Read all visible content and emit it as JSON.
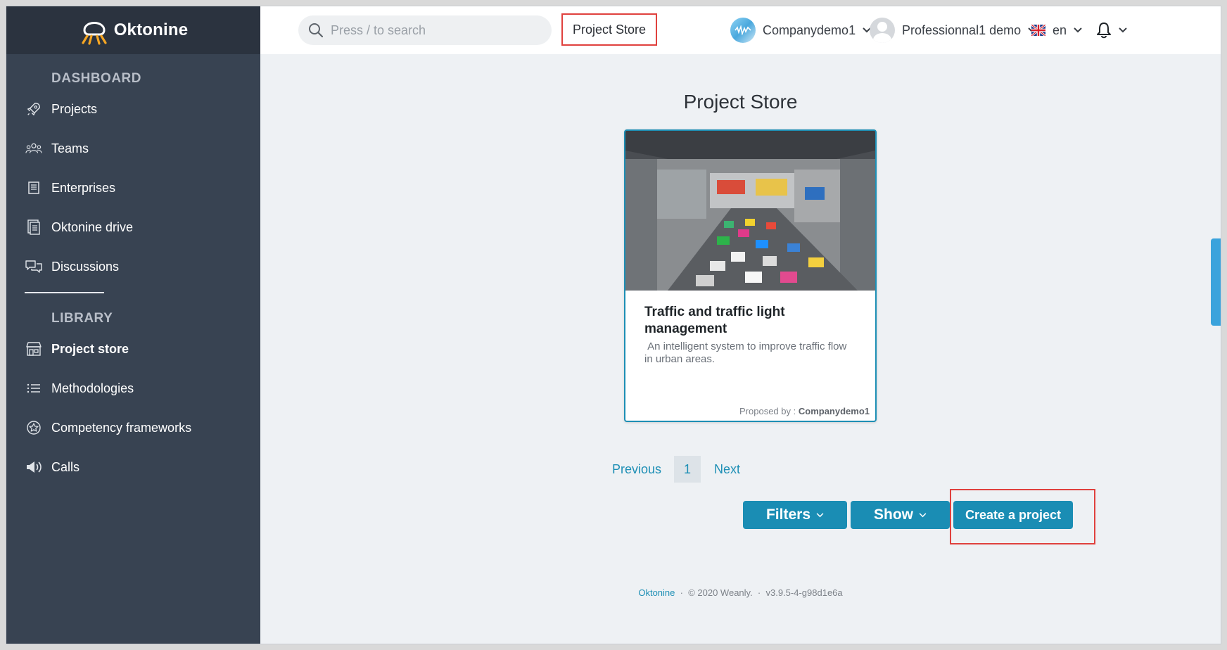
{
  "brand": {
    "name": "Oktonine",
    "accent": "#1a8db4",
    "sidebar_bg": "#384352"
  },
  "search": {
    "placeholder": "Press / to search"
  },
  "header": {
    "active_tab": "Project Store",
    "company": "Companydemo1",
    "user": "Professionnal1 demo",
    "language": "en",
    "icons": [
      "search-icon",
      "chevron-down-icon",
      "uk-flag-icon",
      "bell-icon"
    ]
  },
  "sidebar": {
    "dashboard_title": "DASHBOARD",
    "library_title": "LIBRARY",
    "dashboard_items": [
      {
        "label": "Projects",
        "icon": "rocket-icon"
      },
      {
        "label": "Teams",
        "icon": "team-icon"
      },
      {
        "label": "Enterprises",
        "icon": "enterprise-icon"
      },
      {
        "label": "Oktonine drive",
        "icon": "drive-icon"
      },
      {
        "label": "Discussions",
        "icon": "discussion-icon"
      }
    ],
    "library_items": [
      {
        "label": "Project store",
        "icon": "store-icon",
        "active": true
      },
      {
        "label": "Methodologies",
        "icon": "list-icon"
      },
      {
        "label": "Competency frameworks",
        "icon": "badge-icon"
      },
      {
        "label": "Calls",
        "icon": "megaphone-icon"
      }
    ]
  },
  "main": {
    "title": "Project Store",
    "card": {
      "title": "Traffic and traffic light management",
      "description": " An intelligent system to improve traffic flow in urban areas.",
      "proposed_label": "Proposed by :",
      "proposed_by": "Companydemo1"
    },
    "pagination": {
      "previous": "Previous",
      "current": "1",
      "next": "Next"
    },
    "buttons": {
      "filters": "Filters",
      "show": "Show",
      "create": "Create a project"
    }
  },
  "footer": {
    "brand": "Oktonine",
    "sep": "·",
    "copyright": "© 2020 Weanly.",
    "version": "v3.9.5-4-g98d1e6a"
  }
}
